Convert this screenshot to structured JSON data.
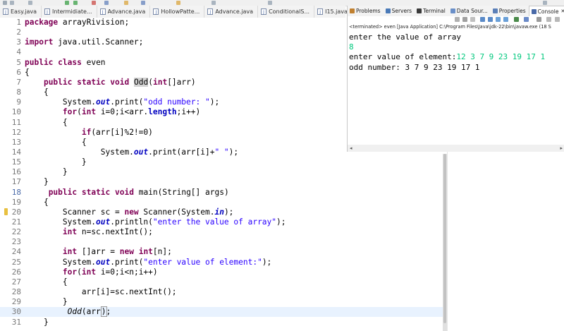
{
  "editor_tabs": [
    {
      "label": "Easy.java"
    },
    {
      "label": "Intermidiate..."
    },
    {
      "label": "Advance.java"
    },
    {
      "label": "HollowPatte..."
    },
    {
      "label": "Advance.java"
    },
    {
      "label": "ConditionalS..."
    },
    {
      "label": "I15.java"
    }
  ],
  "console_tabs": [
    {
      "label": "Problems",
      "color": "#c08030"
    },
    {
      "label": "Servers",
      "color": "#4a7ab8"
    },
    {
      "label": "Terminal",
      "color": "#3a3a3a"
    },
    {
      "label": "Data Sour...",
      "color": "#6a8fc8"
    },
    {
      "label": "Properties",
      "color": "#5a7fb8"
    },
    {
      "label": "Console",
      "color": "#4a6aa8"
    }
  ],
  "console_close": "✕",
  "console_status": "<terminated> even [Java Application] C:\\Program Files\\Java\\jdk-22\\bin\\javaw.exe  (18 S",
  "console_output": {
    "line1": "enter the value of array",
    "line2": "8",
    "line3_prefix": "enter value of element:",
    "line3_input": "12 3 7 9 23 19 17 1",
    "line4": "odd number: 3 7 9 23 19 17 1"
  },
  "code": {
    "l1_kw": "package",
    "l1_rest": " arrayRivision;",
    "l3_kw": "import",
    "l3_rest": " java.util.Scanner;",
    "l5_kw1": "public",
    "l5_kw2": "class",
    "l5_rest": " even",
    "l6": "{",
    "l7_indent": "    ",
    "l7_kw1": "public",
    "l7_kw2": "static",
    "l7_kw3": "void",
    "l7_name": "Odd",
    "l7_kw4": "int",
    "l7_open": "(",
    "l7_rest": "[]arr)",
    "l8": "    {",
    "l9_pre": "        System.",
    "l9_out": "out",
    "l9_mid": ".print(",
    "l9_str": "\"odd number: \"",
    "l9_end": ");",
    "l10_pre": "        ",
    "l10_kw1": "for",
    "l10_a": "(",
    "l10_kw2": "int",
    "l10_b": " i=0;i<arr.",
    "l10_fld": "length",
    "l10_c": ";i++)",
    "l11": "        {",
    "l12_pre": "            ",
    "l12_kw": "if",
    "l12_rest": "(arr[i]%2!=0)",
    "l13": "            {",
    "l14_pre": "                System.",
    "l14_out": "out",
    "l14_mid": ".print(arr[i]+",
    "l14_str": "\" \"",
    "l14_end": ");",
    "l15": "            }",
    "l16": "        }",
    "l17": "    }",
    "l18_indent": "     ",
    "l18_kw1": "public",
    "l18_kw2": "static",
    "l18_kw3": "void",
    "l18_rest": " main(String[] args)",
    "l19": "    {",
    "l20_pre": "        Scanner sc = ",
    "l20_kw": "new",
    "l20_mid": " Scanner(System.",
    "l20_in": "in",
    "l20_end": ");",
    "l21_pre": "        System.",
    "l21_out": "out",
    "l21_mid": ".println(",
    "l21_str": "\"enter the value of array\"",
    "l21_end": ");",
    "l22_pre": "        ",
    "l22_kw": "int",
    "l22_rest": " n=sc.nextInt();",
    "l23": "",
    "l24_pre": "        ",
    "l24_kw1": "int",
    "l24_a": " []arr = ",
    "l24_kw2": "new",
    "l24_sp": " ",
    "l24_kw3": "int",
    "l24_b": "[n];",
    "l25_pre": "        System.",
    "l25_out": "out",
    "l25_mid": ".print(",
    "l25_str": "\"enter value of element:\"",
    "l25_end": ");",
    "l26_pre": "        ",
    "l26_kw1": "for",
    "l26_a": "(",
    "l26_kw2": "int",
    "l26_b": " i=0;i<n;i++)",
    "l27": "        {",
    "l28": "            arr[i]=sc.nextInt();",
    "l29": "        }",
    "l30_pre": "         ",
    "l30_call": "Odd",
    "l30_a": "(arr",
    "l30_b": ")",
    "l30_c": ";",
    "l31": "    }"
  },
  "line_numbers": [
    "1",
    "2",
    "3",
    "4",
    "5",
    "6",
    "7",
    "8",
    "9",
    "10",
    "11",
    "12",
    "13",
    "14",
    "15",
    "16",
    "17",
    "18",
    "19",
    "20",
    "21",
    "22",
    "23",
    "24",
    "25",
    "26",
    "27",
    "28",
    "29",
    "30",
    "31"
  ]
}
